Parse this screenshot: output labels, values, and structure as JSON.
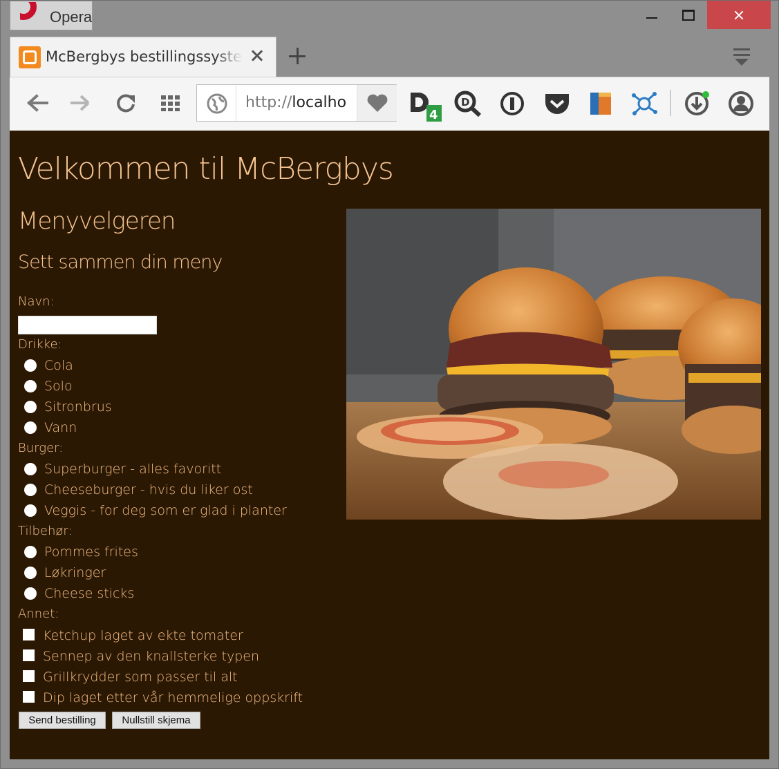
{
  "window": {
    "app_name": "Opera"
  },
  "tab": {
    "title": "McBergbys bestillingssystem"
  },
  "address_bar": {
    "scheme": "http://",
    "host": "localho"
  },
  "page": {
    "heading": "Velkommen til McBergbys",
    "subheading": "Menyvelgeren",
    "section_title": "Sett sammen din meny",
    "name_label": "Navn:",
    "name_value": "",
    "drinks": {
      "label": "Drikke:",
      "options": [
        "Cola",
        "Solo",
        "Sitronbrus",
        "Vann"
      ]
    },
    "burgers": {
      "label": "Burger:",
      "options": [
        "Superburger - alles favoritt",
        "Cheeseburger - hvis du liker ost",
        "Veggis - for deg som er glad i planter"
      ]
    },
    "sides": {
      "label": "Tilbehør:",
      "options": [
        "Pommes frites",
        "Løkringer",
        "Cheese sticks"
      ]
    },
    "extras": {
      "label": "Annet:",
      "options": [
        "Ketchup laget av ekte tomater",
        "Sennep av den knallsterke typen",
        "Grillkrydder som passer til alt",
        "Dip laget etter vår hemmelige oppskrift"
      ]
    },
    "submit_label": "Send bestilling",
    "reset_label": "Nullstill skjema"
  },
  "colors": {
    "page_bg": "#2b1803",
    "text": "#f4c28f",
    "close_button": "#c9474a",
    "opera_red": "#c8102e"
  },
  "icons": [
    "back-icon",
    "forward-icon",
    "reload-icon",
    "speed-dial-icon",
    "site-info-icon",
    "bookmark-heart-icon",
    "extension-d4-icon",
    "extension-search-icon",
    "extension-password-icon",
    "pocket-icon",
    "extension-book-icon",
    "extension-network-icon",
    "downloads-icon",
    "account-icon",
    "tab-menu-icon"
  ]
}
